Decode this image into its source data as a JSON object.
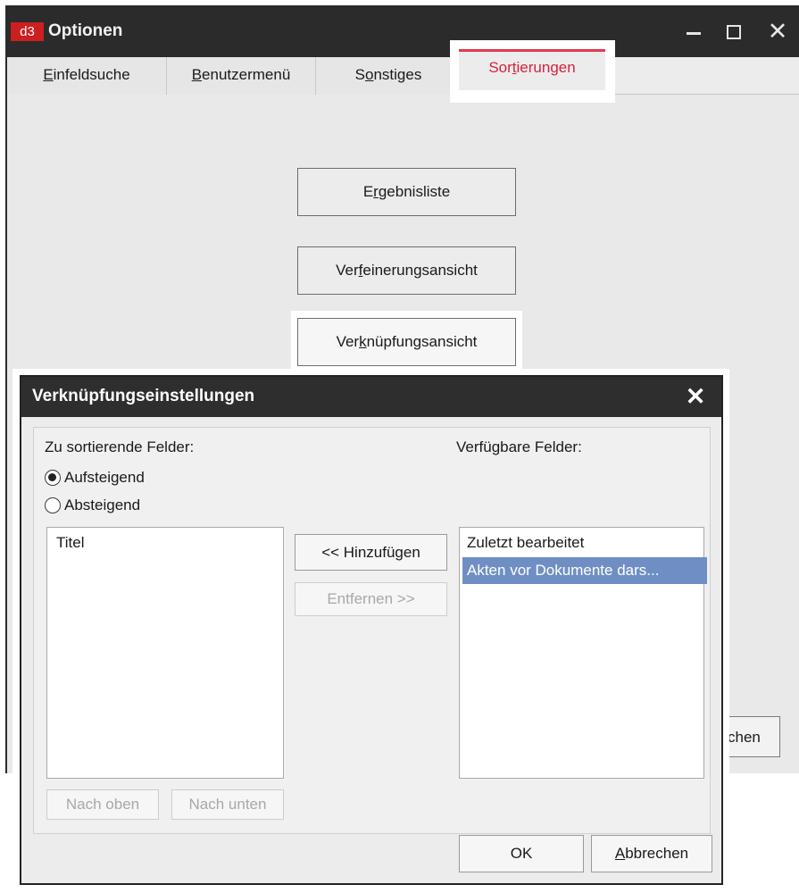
{
  "options_window": {
    "logo": "d3",
    "title": "Optionen",
    "tabs": [
      {
        "pre": "",
        "key": "E",
        "post": "infeldsuche"
      },
      {
        "pre": "",
        "key": "B",
        "post": "enutzermenü"
      },
      {
        "pre": "S",
        "key": "o",
        "post": "nstiges"
      },
      {
        "pre": "Sor",
        "key": "t",
        "post": "ierungen"
      }
    ],
    "selected_tab": "Sortierungen",
    "buttons": {
      "ergebnisliste": {
        "pre": "E",
        "key": "r",
        "post": "gebnisliste"
      },
      "verfeinerung": {
        "pre": "Ver",
        "key": "f",
        "post": "einerungsansicht"
      },
      "verknuepfung": {
        "pre": "Ver",
        "key": "k",
        "post": "nüpfungsansicht"
      },
      "abbrechen_partial": "chen"
    }
  },
  "dialog": {
    "title": "Verknüpfungseinstellungen",
    "sort_label": "Zu sortierende Felder:",
    "available_label": "Verfügbare Felder:",
    "radio_ascending": "Aufsteigend",
    "radio_descending": "Absteigend",
    "sort_fields": [
      "Titel"
    ],
    "available_fields": [
      "Zuletzt bearbeitet",
      "Akten vor Dokumente dars..."
    ],
    "add_button": "<< Hinzufügen",
    "remove_button": "Entfernen >>",
    "up_button": "Nach oben",
    "down_button": "Nach unten",
    "ok_button": "OK",
    "cancel_button": {
      "pre": "",
      "key": "A",
      "post": "bbrechen"
    }
  },
  "colors": {
    "titlebar": "#2b2b2b",
    "accent_tab": "#d4243c",
    "logo": "#cc1f1f",
    "selection": "#6f8fc4"
  }
}
